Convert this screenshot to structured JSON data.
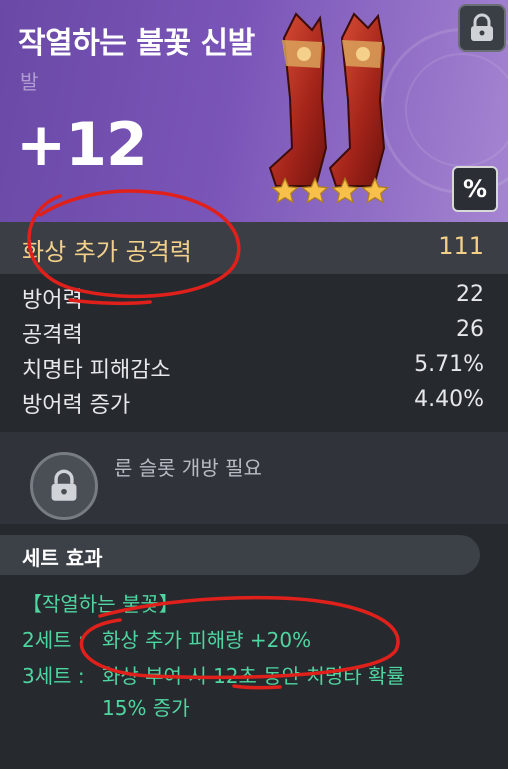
{
  "item": {
    "name": "작열하는 불꽃 신발",
    "type": "발",
    "enhance_level": "+12",
    "stars": 4,
    "percent_toggle_label": "%"
  },
  "main_stat": {
    "label": "화상 추가 공격력",
    "value": "111"
  },
  "sub_stats": [
    {
      "label": "방어력",
      "value": "22"
    },
    {
      "label": "공격력",
      "value": "26"
    },
    {
      "label": "치명타 피해감소",
      "value": "5.71%"
    },
    {
      "label": "방어력 증가",
      "value": "4.40%"
    }
  ],
  "rune": {
    "text": "룬 슬롯 개방 필요",
    "icon": "lock-icon"
  },
  "set_effect": {
    "header": "세트 효과",
    "set_name": "【작열하는 불꽃】",
    "effects": [
      {
        "prefix": "2세트 :",
        "text": "화상 추가 피해량 +20%"
      },
      {
        "prefix": "3세트 :",
        "text": "화상 부여 시 12초 동안 치명타 확률",
        "text_cont": "15% 증가"
      }
    ]
  },
  "colors": {
    "header_purple": "#7a55b8",
    "main_stat_gold": "#f2d08a",
    "set_effect_green": "#4fd6a0",
    "annotation_red": "#e0201a"
  }
}
